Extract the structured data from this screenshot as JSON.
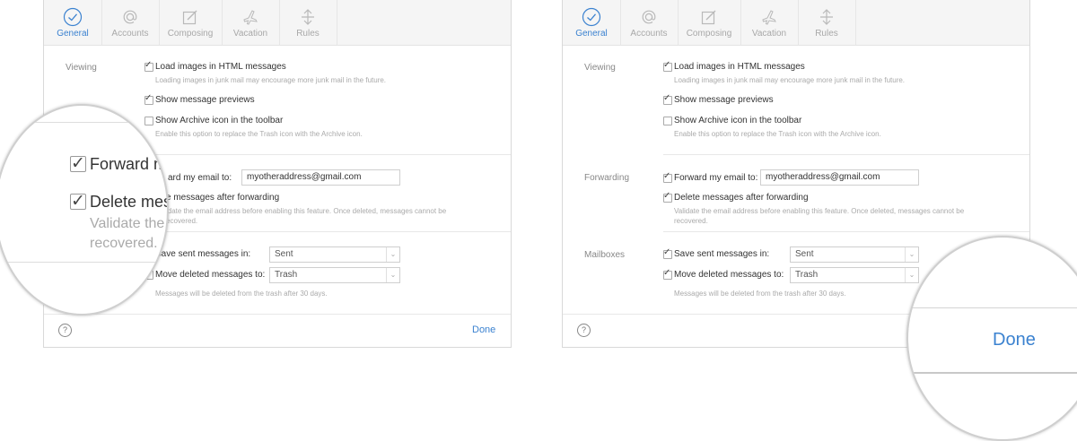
{
  "tabs": [
    {
      "label": "General",
      "icon": "checkmark-circle-icon"
    },
    {
      "label": "Accounts",
      "icon": "at-sign-icon"
    },
    {
      "label": "Composing",
      "icon": "compose-icon"
    },
    {
      "label": "Vacation",
      "icon": "airplane-icon"
    },
    {
      "label": "Rules",
      "icon": "arrows-icon"
    }
  ],
  "viewing": {
    "section": "Viewing",
    "load_images": "Load images in HTML messages",
    "load_images_note": "Loading images in junk mail may encourage more junk mail in the future.",
    "show_previews": "Show message previews",
    "show_archive": "Show Archive icon in the toolbar",
    "show_archive_note": "Enable this option to replace the Trash icon with the Archive icon."
  },
  "forwarding": {
    "section": "Forwarding",
    "forward_label": "Forward my email to:",
    "forward_label_partial": "ard my email to:",
    "forward_value": "myotheraddress@gmail.com",
    "delete_after": "Delete messages after forwarding",
    "delete_after_partial": "e messages after forwarding",
    "validate_note_1": "Validate the email address before enabling this feature. Once deleted, messages cannot be",
    "validate_note_1_partial": "idate the email address before enabling this feature. Once deleted, messages cannot be",
    "validate_note_2": "recovered.",
    "validate_note_2_partial": "ecovered."
  },
  "mailboxes": {
    "section": "Mailboxes",
    "save_sent_label": "Save sent messages in:",
    "save_sent_value": "Sent",
    "move_deleted_label": "Move deleted messages to:",
    "move_deleted_value": "Trash",
    "trash_note": "Messages will be deleted from the trash after 30 days."
  },
  "footer": {
    "help": "?",
    "done": "Done"
  },
  "magnifier_left": {
    "line1": "Forward m",
    "line2": "Delete mes",
    "line3": "Validate the",
    "line4": "recovered."
  },
  "magnifier_right": {
    "done": "Done"
  },
  "colors": {
    "accent": "#3b82d0",
    "toolbar_bg": "#f5f5f5"
  }
}
